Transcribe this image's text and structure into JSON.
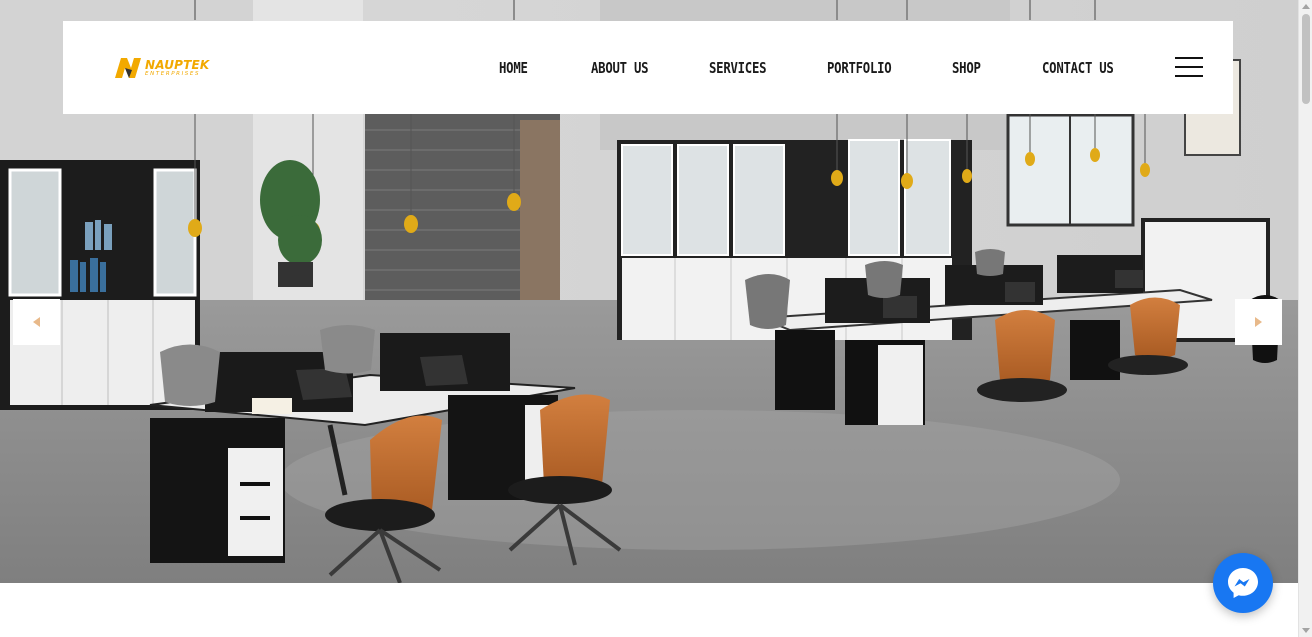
{
  "brand": {
    "name": "NAUPTEK",
    "subtitle": "ENTERPRISES",
    "accent_color": "#f2a900"
  },
  "nav": {
    "items": [
      {
        "label": "HOME"
      },
      {
        "label": "ABOUT US"
      },
      {
        "label": "SERVICES"
      },
      {
        "label": "PORTFOLIO"
      },
      {
        "label": "SHOP"
      },
      {
        "label": "CONTACT US"
      }
    ],
    "menu_icon": "hamburger-icon"
  },
  "slider": {
    "prev_icon": "chevron-left-icon",
    "next_icon": "chevron-right-icon",
    "arrow_color": "#e8b98a"
  },
  "chat": {
    "icon": "messenger-icon",
    "color": "#1877f2"
  }
}
